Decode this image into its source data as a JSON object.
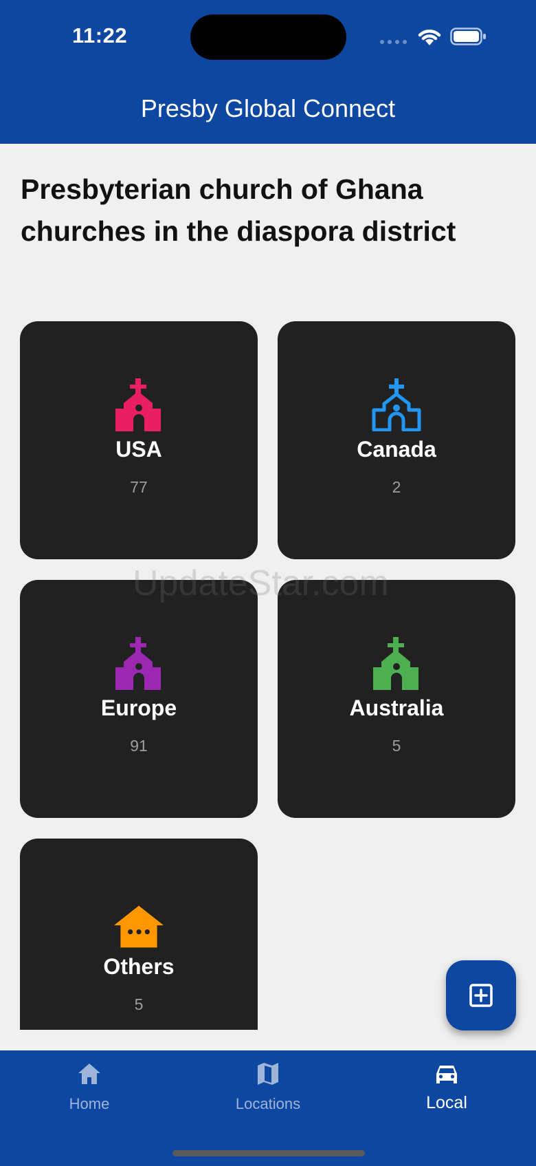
{
  "status_bar": {
    "time": "11:22"
  },
  "app_bar": {
    "title": "Presby Global Connect"
  },
  "heading": "Presbyterian church of Ghana churches in the diaspora district",
  "watermark": "UpdateStar.com",
  "regions": [
    {
      "name": "USA",
      "count": "77",
      "icon": "church-icon",
      "color": "#e91e63"
    },
    {
      "name": "Canada",
      "count": "2",
      "icon": "church-outline-icon",
      "color": "#2196f3"
    },
    {
      "name": "Europe",
      "count": "91",
      "icon": "church-icon",
      "color": "#9c27b0"
    },
    {
      "name": "Australia",
      "count": "5",
      "icon": "church-icon",
      "color": "#4caf50"
    },
    {
      "name": "Others",
      "count": "5",
      "icon": "house-dots-icon",
      "color": "#ff9800"
    }
  ],
  "fab": {
    "icon": "add-box-icon"
  },
  "bottom_nav": {
    "items": [
      {
        "label": "Home",
        "icon": "home-icon",
        "active": false
      },
      {
        "label": "Locations",
        "icon": "map-icon",
        "active": false
      },
      {
        "label": "Local",
        "icon": "car-icon",
        "active": true
      }
    ]
  },
  "colors": {
    "primary": "#0d47a1",
    "card": "#212121",
    "background": "#f0f0f0"
  }
}
